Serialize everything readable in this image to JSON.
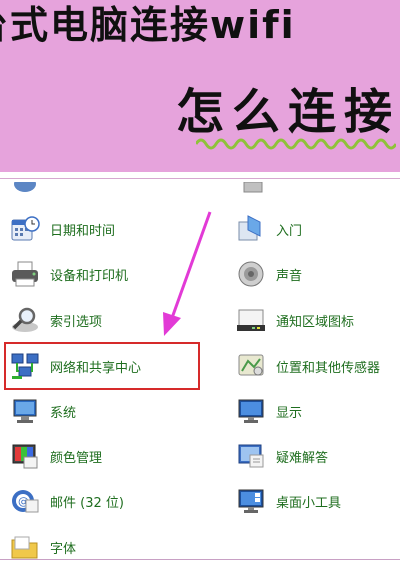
{
  "banner": {
    "line1": "台式电脑连接wifi",
    "line2": "怎么连接"
  },
  "left_items": [
    {
      "label": "日期和时间",
      "icon": "calendar-clock-icon"
    },
    {
      "label": "设备和打印机",
      "icon": "printer-icon"
    },
    {
      "label": "索引选项",
      "icon": "magnifier-icon"
    },
    {
      "label": "网络和共享中心",
      "icon": "network-icon"
    },
    {
      "label": "系统",
      "icon": "computer-icon"
    },
    {
      "label": "颜色管理",
      "icon": "color-management-icon"
    },
    {
      "label": "邮件 (32 位)",
      "icon": "mail-icon"
    },
    {
      "label": "字体",
      "icon": "font-folder-icon"
    }
  ],
  "right_items": [
    {
      "label": "入门",
      "icon": "getting-started-icon"
    },
    {
      "label": "声音",
      "icon": "speaker-icon"
    },
    {
      "label": "通知区域图标",
      "icon": "notification-area-icon"
    },
    {
      "label": "位置和其他传感器",
      "icon": "location-sensor-icon"
    },
    {
      "label": "显示",
      "icon": "display-icon"
    },
    {
      "label": "疑难解答",
      "icon": "troubleshooting-icon"
    },
    {
      "label": "桌面小工具",
      "icon": "gadgets-icon"
    }
  ],
  "colors": {
    "banner_bg": "#e6a3dc",
    "label_green": "#1f6e1f",
    "highlight_red": "#d62a2a",
    "arrow_magenta": "#e23ad6",
    "squiggle_green": "#8fc23a"
  }
}
